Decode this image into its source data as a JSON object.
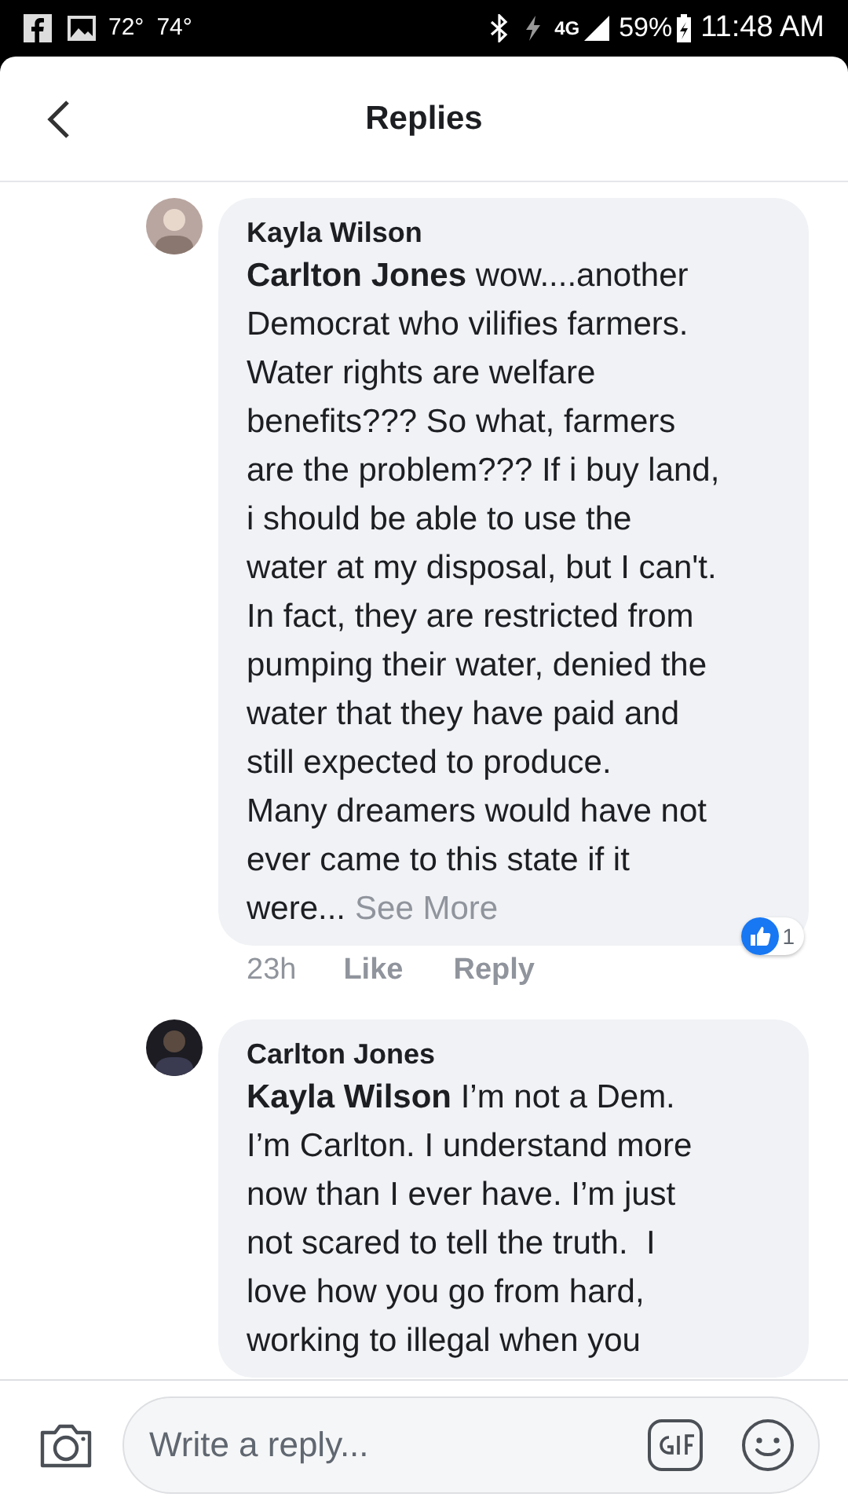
{
  "status_bar": {
    "temps": [
      "72°",
      "74°"
    ],
    "network": "4G",
    "battery": "59%",
    "time": "11:48 AM"
  },
  "header": {
    "title": "Replies"
  },
  "comments": [
    {
      "author": "Kayla Wilson",
      "lines": [
        "**Carlton Jones** wow....another",
        "Democrat who vilifies farmers.",
        "Water rights are welfare",
        "benefits??? So what, farmers",
        "are the problem??? If i buy land,",
        "i should be able to use the",
        "water at my disposal, but I can't.",
        "In fact, they are restricted from",
        "pumping their water, denied the",
        "water that they have paid and",
        "still expected to produce.",
        "Many dreamers would have not",
        "ever came to this state if it",
        "were..."
      ],
      "see_more": "See More",
      "time": "23h",
      "like": "Like",
      "reply": "Reply",
      "reactions": "1"
    },
    {
      "author": "Carlton Jones",
      "lines": [
        "**Kayla Wilson** I’m not a Dem.",
        "I’m Carlton. I understand more",
        "now than I ever have. I’m just",
        "not scared to tell the truth.  I",
        "love how you go from hard,",
        "working to illegal when you"
      ]
    }
  ],
  "composer": {
    "placeholder": "Write a reply..."
  }
}
